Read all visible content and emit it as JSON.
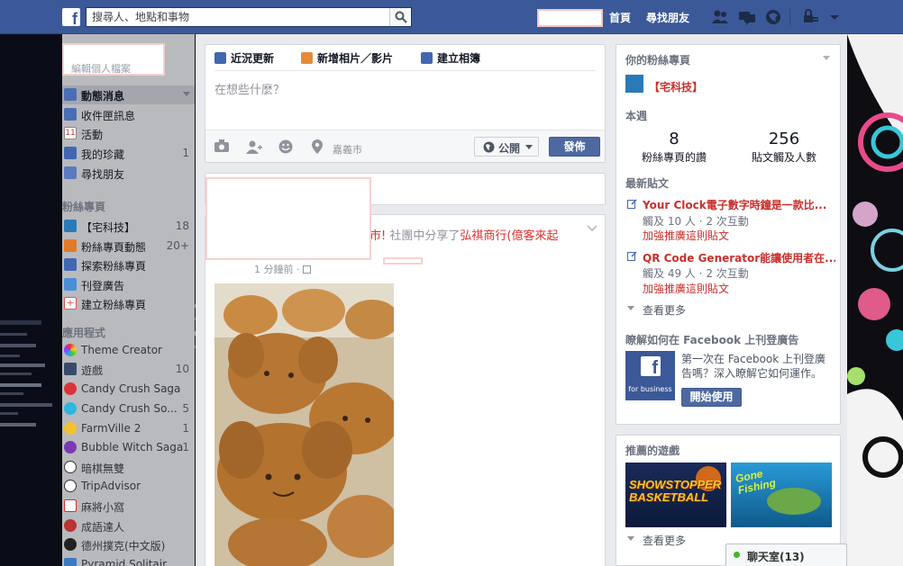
{
  "topbar": {
    "logo": "f",
    "search_placeholder": "搜尋人、地點和事物",
    "home_label": "首頁",
    "find_friends_label": "尋找朋友",
    "brand_color": "#3b5998"
  },
  "sidebar": {
    "profile_name_fragment": "編輯個人檔案",
    "main_items": [
      {
        "label": "動態消息",
        "count": "",
        "icon": "news-feed-icon",
        "selected": true
      },
      {
        "label": "收件匣訊息",
        "count": "",
        "icon": "messages-icon"
      },
      {
        "label": "活動",
        "count": "",
        "icon": "events-icon"
      },
      {
        "label": "我的珍藏",
        "count": "1",
        "icon": "saved-icon"
      },
      {
        "label": "尋找朋友",
        "count": "",
        "icon": "find-friends-icon"
      }
    ],
    "pages_heading": "粉絲專頁",
    "page_items": [
      {
        "label": "【宅科技】",
        "count": "18",
        "icon": "page-avatar-icon"
      },
      {
        "label": "粉絲專頁動態",
        "count": "20+",
        "icon": "pages-feed-icon"
      },
      {
        "label": "探索粉絲專頁",
        "count": "",
        "icon": "like-pages-icon"
      },
      {
        "label": "刊登廣告",
        "count": "",
        "icon": "create-ad-icon"
      },
      {
        "label": "建立粉絲專頁",
        "count": "",
        "icon": "create-page-icon"
      }
    ],
    "apps_heading": "應用程式",
    "app_items": [
      {
        "label": "Theme Creator",
        "count": "",
        "icon": "theme-creator-icon"
      },
      {
        "label": "遊戲",
        "count": "10",
        "icon": "games-icon"
      },
      {
        "label": "Candy Crush Saga",
        "count": "",
        "icon": "candy-crush-icon"
      },
      {
        "label": "Candy Crush So...",
        "count": "5",
        "icon": "candy-crush-soda-icon"
      },
      {
        "label": "FarmVille 2",
        "count": "1",
        "icon": "farmville-icon"
      },
      {
        "label": "Bubble Witch Saga",
        "count": "1",
        "icon": "bubble-witch-icon"
      },
      {
        "label": "暗棋無雙",
        "count": "",
        "icon": "chess-icon"
      },
      {
        "label": "TripAdvisor",
        "count": "",
        "icon": "tripadvisor-icon"
      },
      {
        "label": "麻將小窩",
        "count": "",
        "icon": "mahjong-icon"
      },
      {
        "label": "成語達人",
        "count": "",
        "icon": "idiom-icon"
      },
      {
        "label": "德州撲克(中文版)",
        "count": "",
        "icon": "poker-icon"
      },
      {
        "label": "Pyramid Solitair...",
        "count": "",
        "icon": "solitaire-icon"
      }
    ]
  },
  "composer": {
    "tabs": [
      {
        "label": "近況更新",
        "icon": "pencil-icon"
      },
      {
        "label": "新增相片／影片",
        "icon": "photo-icon"
      },
      {
        "label": "建立相簿",
        "icon": "album-icon"
      }
    ],
    "placeholder": "在想些什麼？",
    "location": "嘉義市",
    "privacy_label": "公開",
    "post_label": "發佈"
  },
  "story": {
    "text_visible": "市! ",
    "text_grey": "社團中分享了",
    "link": "弘祺商行(億客來起",
    "time": "1 分鐘前 · "
  },
  "right": {
    "pages_heading": "你的粉絲專頁",
    "page_name": "【宅科技】",
    "week_heading": "本週",
    "stat1_value": "8",
    "stat1_label": "粉絲專頁的讚",
    "stat2_value": "256",
    "stat2_label": "貼文觸及人數",
    "recent_heading": "最新貼文",
    "posts": [
      {
        "title": "Your Clock電子數字時鐘是一款比...",
        "meta": "觸及 10 人 · 2 次互動",
        "boost": "加強推廣這則貼文"
      },
      {
        "title": "QR Code Generator能讓使用者在...",
        "meta": "觸及 49 人 · 2 次互動",
        "boost": "加強推廣這則貼文"
      }
    ],
    "see_more": "查看更多",
    "ads_heading": "瞭解如何在 Facebook 上刊登廣告",
    "ads_text": "第一次在 Facebook 上刊登廣告嗎？深入瞭解它如何運作。",
    "ads_logo_text": "for business",
    "ads_button": "開始使用",
    "games_heading": "推薦的遊戲",
    "game1": "SHOWSTOPPER BASKETBALL",
    "game2": "Gone Fishing",
    "games_see_more": "查看更多"
  },
  "chat": {
    "label": "聊天室(13)"
  }
}
